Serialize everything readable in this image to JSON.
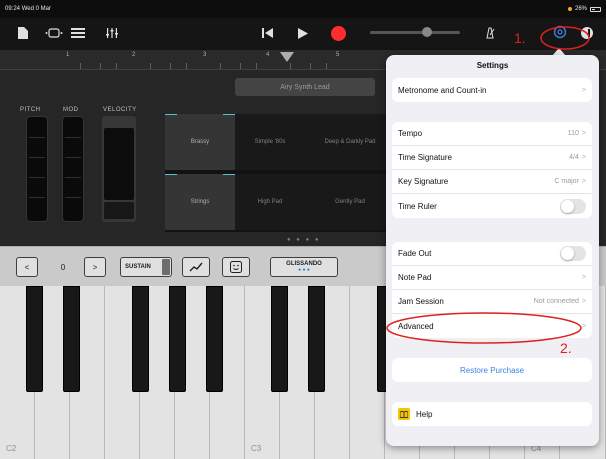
{
  "status": {
    "time": "09:24",
    "date": "Wed 0 Mar",
    "battery": "26%"
  },
  "toolbar": {
    "play_glyph": "▶",
    "rewind_glyph": "⏮"
  },
  "ruler": {
    "marks": [
      "1",
      "2",
      "3",
      "4",
      "5"
    ]
  },
  "instrument": {
    "preset": "Airy Synth Lead"
  },
  "knobs": {
    "pitch": "PITCH",
    "mod": "MOD",
    "velocity": "VELOCITY"
  },
  "pads": [
    {
      "label": "Brassy"
    },
    {
      "label": "Simple '80s"
    },
    {
      "label": "Deep & Darkly Pad"
    },
    {
      "label": "Strings"
    },
    {
      "label": "High Pad"
    },
    {
      "label": "Gently Pad"
    }
  ],
  "page_dots": "● ● ● ●",
  "controls": {
    "octave_down": "<",
    "octave_value": "0",
    "octave_up": ">",
    "sustain": "SUSTAIN",
    "glissando": "GLISSANDO",
    "glissando_dots": "● ● ●"
  },
  "keyboard": {
    "labels": [
      "C2",
      "C3",
      "C4"
    ]
  },
  "settings": {
    "title": "Settings",
    "group1": [
      {
        "label": "Metronome and Count-in",
        "value": ""
      }
    ],
    "group2": [
      {
        "label": "Tempo",
        "value": "110"
      },
      {
        "label": "Time Signature",
        "value": "4/4"
      },
      {
        "label": "Key Signature",
        "value": "C major"
      },
      {
        "label": "Time Ruler",
        "value": ""
      }
    ],
    "group3": [
      {
        "label": "Fade Out",
        "value": ""
      },
      {
        "label": "Note Pad",
        "value": ""
      },
      {
        "label": "Jam Session",
        "value": "Not connected"
      },
      {
        "label": "Advanced",
        "value": ""
      }
    ],
    "restore": "Restore Purchase",
    "help": "Help",
    "help_icon": "book-icon"
  },
  "annotations": {
    "one": "1.",
    "two": "2."
  },
  "colors": {
    "annotation": "#e02020",
    "accent": "#3a84e0",
    "record": "#ff2d2d"
  }
}
